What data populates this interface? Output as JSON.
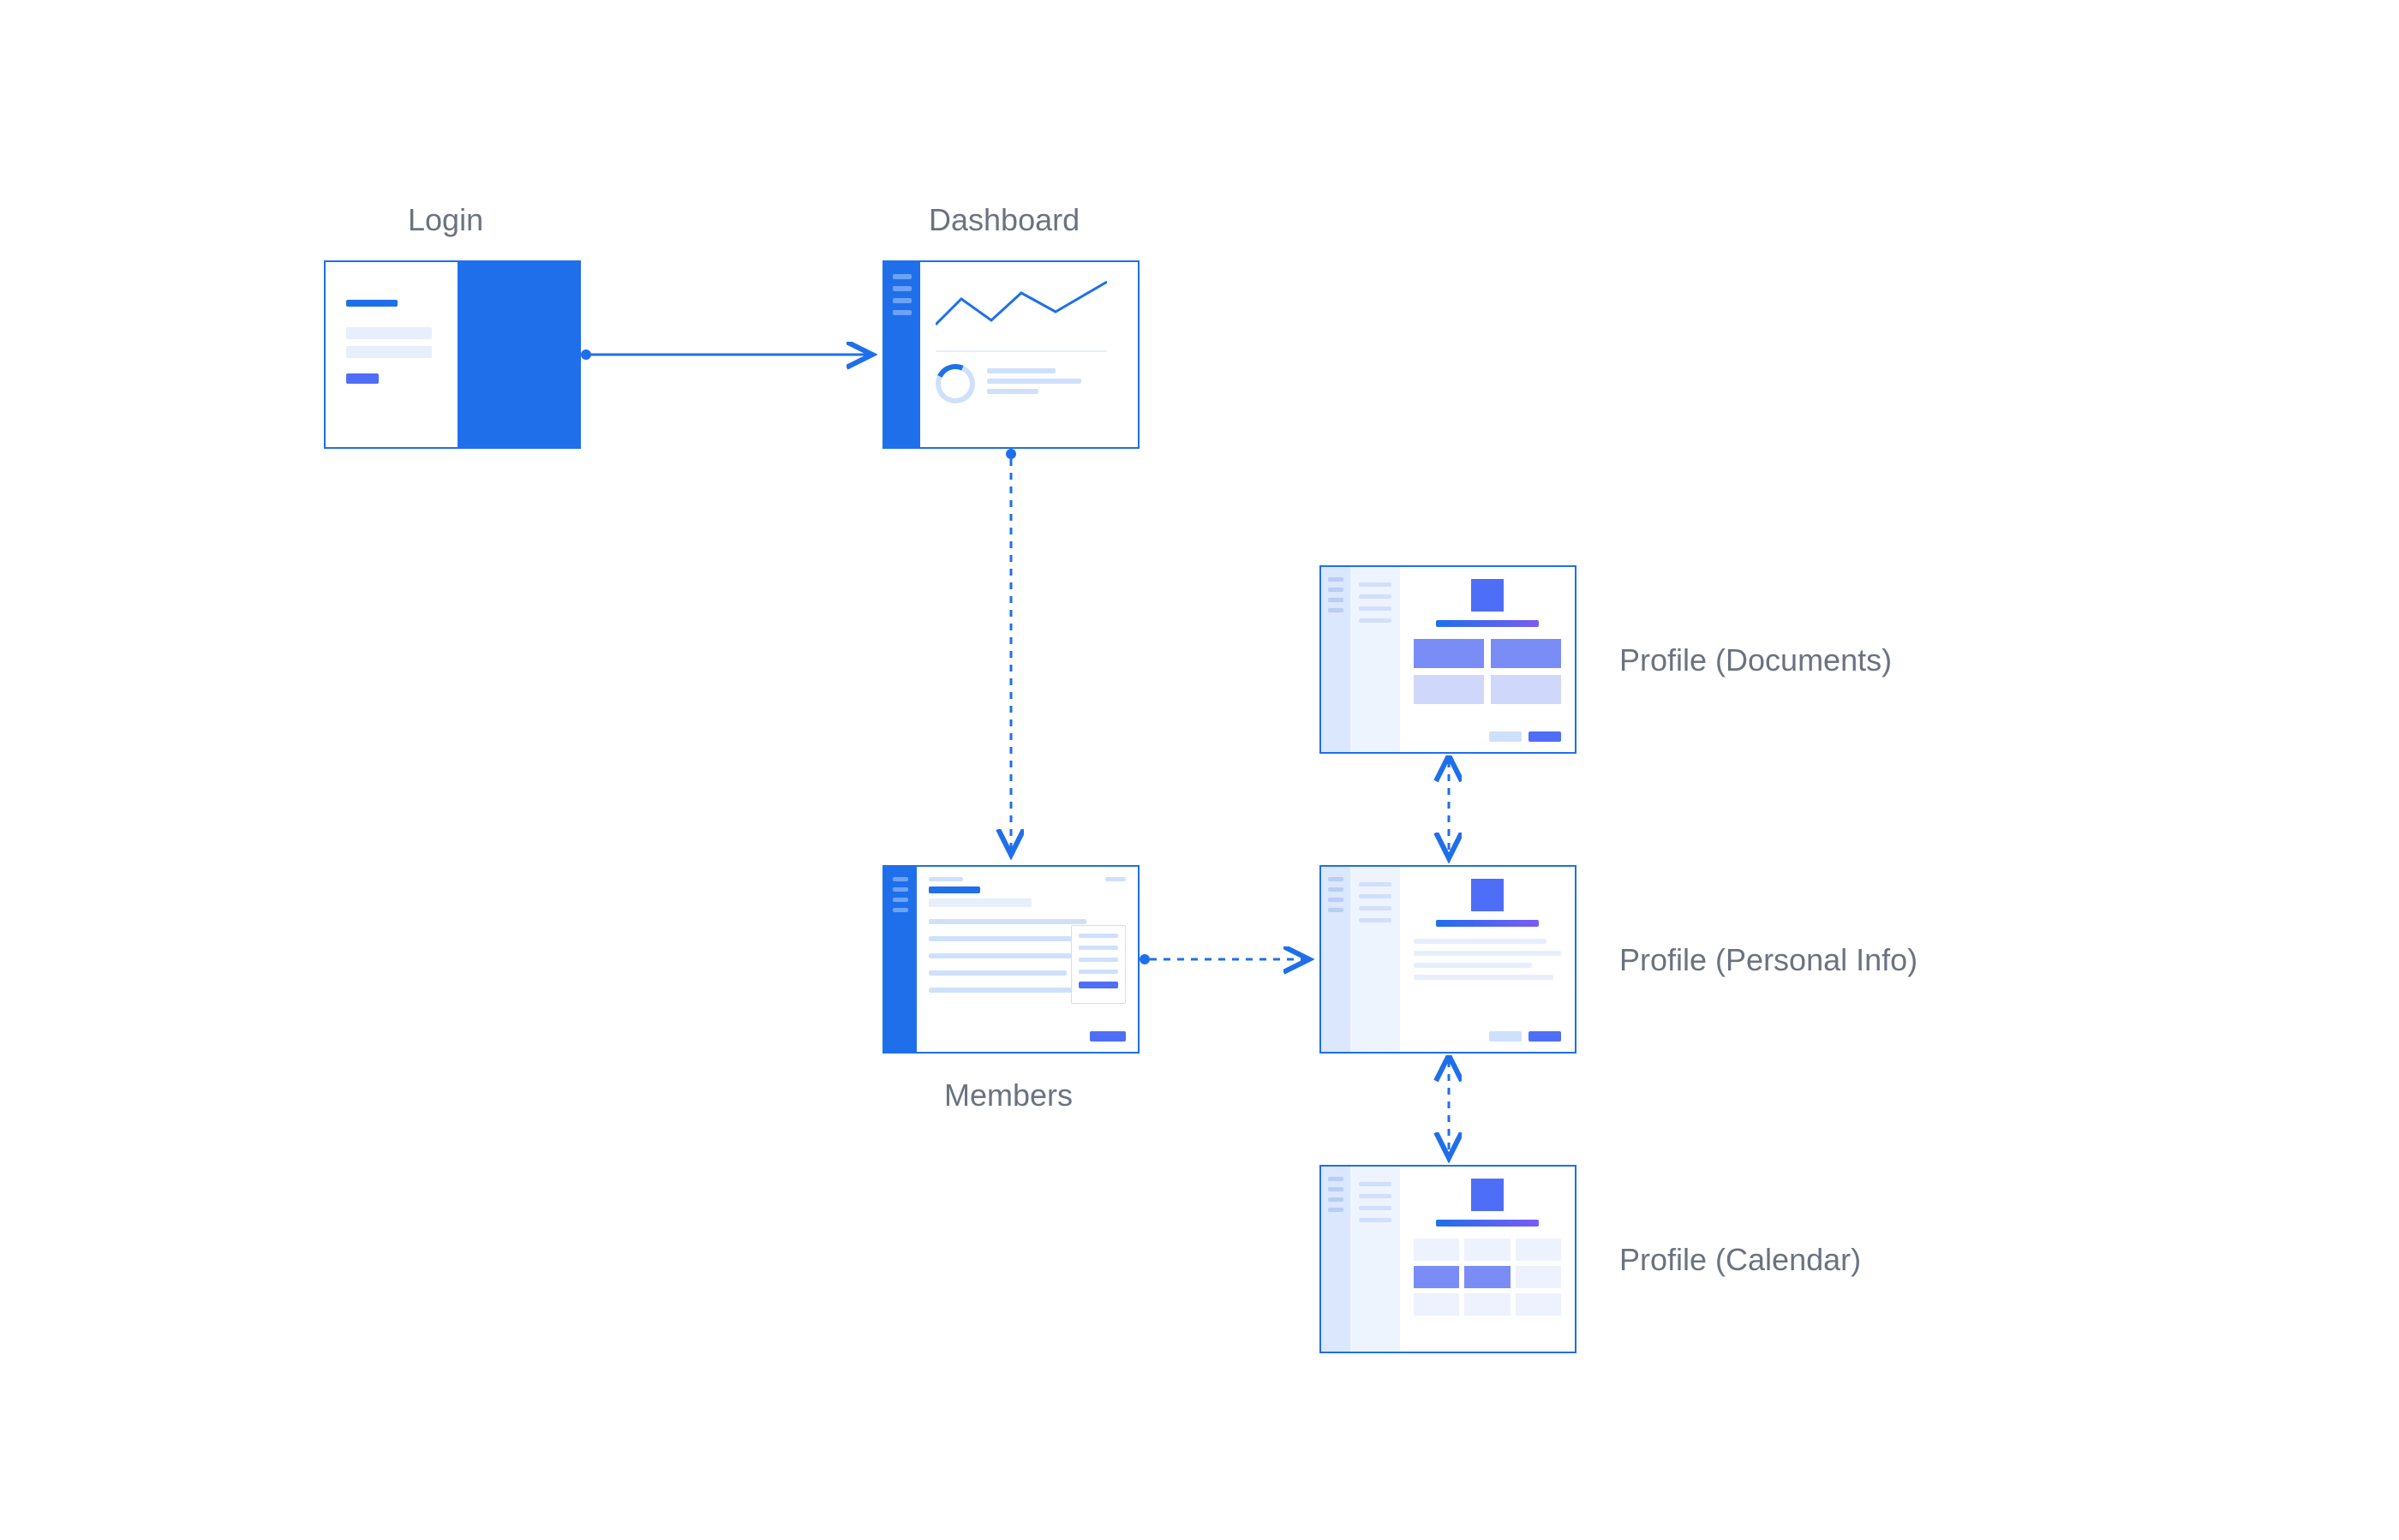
{
  "nodes": {
    "login": {
      "label": "Login"
    },
    "dashboard": {
      "label": "Dashboard"
    },
    "members": {
      "label": "Members"
    },
    "profile_documents": {
      "label": "Profile (Documents)"
    },
    "profile_personal": {
      "label": "Profile (Personal Info)"
    },
    "profile_calendar": {
      "label": "Profile (Calendar)"
    }
  },
  "edges": [
    {
      "from": "login",
      "to": "dashboard",
      "style": "solid",
      "direction": "one-way"
    },
    {
      "from": "dashboard",
      "to": "members",
      "style": "dashed",
      "direction": "one-way"
    },
    {
      "from": "members",
      "to": "profile_personal",
      "style": "dashed",
      "direction": "one-way"
    },
    {
      "from": "profile_documents",
      "to": "profile_personal",
      "style": "dashed",
      "direction": "two-way"
    },
    {
      "from": "profile_personal",
      "to": "profile_calendar",
      "style": "dashed",
      "direction": "two-way"
    }
  ],
  "colors": {
    "brand_blue": "#1f6feb",
    "accent_violet": "#4f6ef7",
    "pale_blue": "#cfe0fb",
    "text_gray": "#6b7280"
  }
}
